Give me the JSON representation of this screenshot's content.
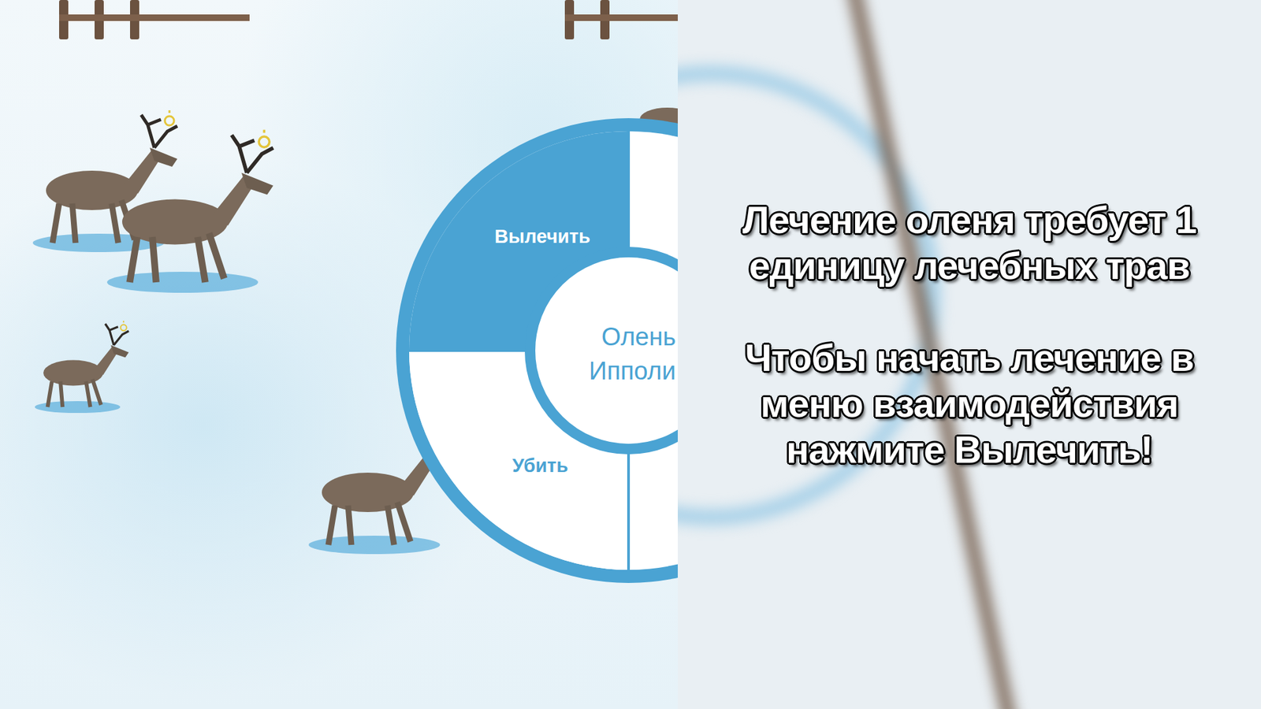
{
  "radial_menu": {
    "name_lines": [
      "Олень",
      "Ипполи"
    ],
    "items": [
      {
        "label": "Вылечить",
        "selected": true
      },
      {
        "label": "Убить",
        "selected": false
      }
    ]
  },
  "hint": {
    "paragraphs": [
      "Лечение оленя требует 1 единицу лечебных трав",
      "Чтобы начать лечение в меню взаимодействия нажмите Вылечить!"
    ]
  }
}
